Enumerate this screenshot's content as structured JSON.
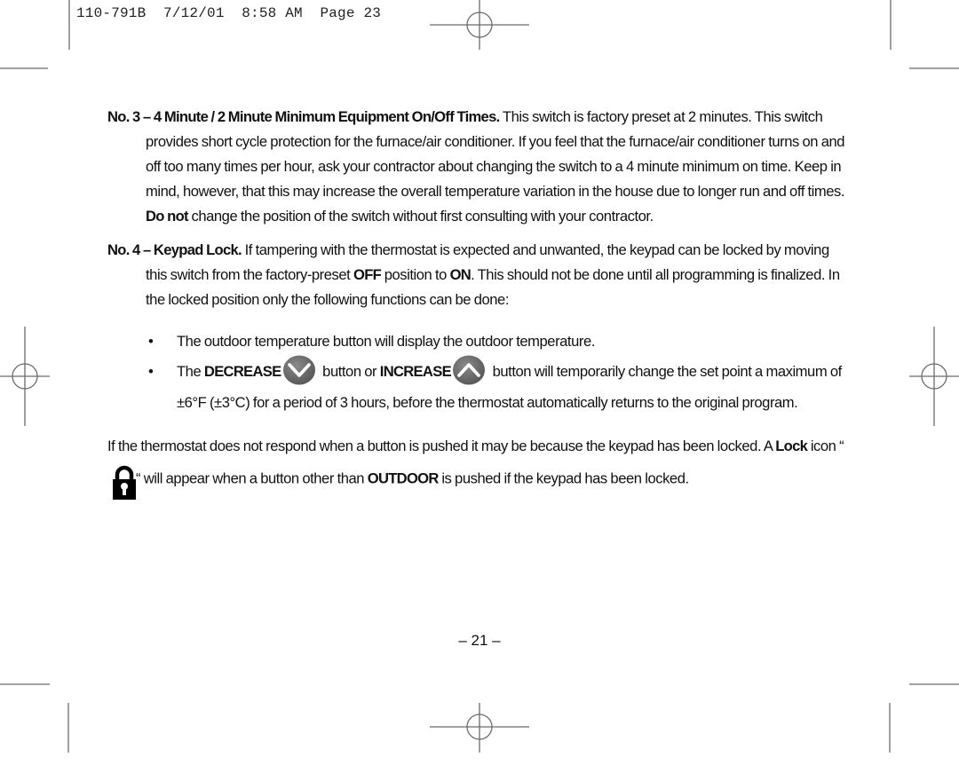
{
  "slug_line": "110-791B  7/12/01  8:58 AM  Page 23",
  "section3": {
    "heading": "No. 3 – 4 Minute / 2 Minute Minimum Equipment On/Off Times.",
    "text_before_bold": " This switch is factory preset at 2 minutes. This switch provides short cycle protection for the furnace/air conditioner. If you feel that the furnace/air conditioner turns on and off too many times per hour, ask your contractor about changing the switch to a 4 minute minimum on time. Keep in mind, however, that this may increase the overall temperature variation in the house due to longer run and off times. ",
    "bold_phrase": "Do not",
    "text_after_bold": " change the position of the switch without first consulting with your contractor."
  },
  "section4": {
    "heading": "No. 4 – Keypad Lock.",
    "text_1": " If tampering with the thermostat is expected and unwanted, the keypad can be locked by moving this switch from the factory-preset ",
    "bold_off": "OFF",
    "text_2": " position to ",
    "bold_on": "ON",
    "text_3": ". This should not be done until all programming is finalized. In the locked position only the following functions can be done:"
  },
  "bullets": {
    "marker": "•",
    "item1": "The outdoor temperature button will display the outdoor temperature.",
    "item2": {
      "text_1": "The ",
      "bold_decrease": "DECREASE",
      "decrease_icon": "chevron-down-circle-icon",
      "text_2": " button or ",
      "bold_increase": "INCREASE",
      "increase_icon": "chevron-up-circle-icon",
      "text_3": " button will temporarily change the set point a maximum of ±6°F (±3°C) for a period of 3 hours, before the thermostat automatically returns to the original program."
    }
  },
  "closing": {
    "text_1": "If the thermostat does not respond when a button is pushed it may be because the keypad has been locked. A ",
    "bold_lock": "Lock",
    "text_2": " icon “",
    "lock_icon": "padlock-icon",
    "text_3": "“ will appear when a button other than ",
    "bold_outdoor": "OUTDOOR",
    "text_4": " is pushed if the keypad has been locked."
  },
  "page_number": "– 21 –",
  "colors": {
    "text": "#111111",
    "marks": "#6b6b6b",
    "button_icon_fill": "#6e6e6e",
    "lock_icon_fill": "#000000"
  }
}
